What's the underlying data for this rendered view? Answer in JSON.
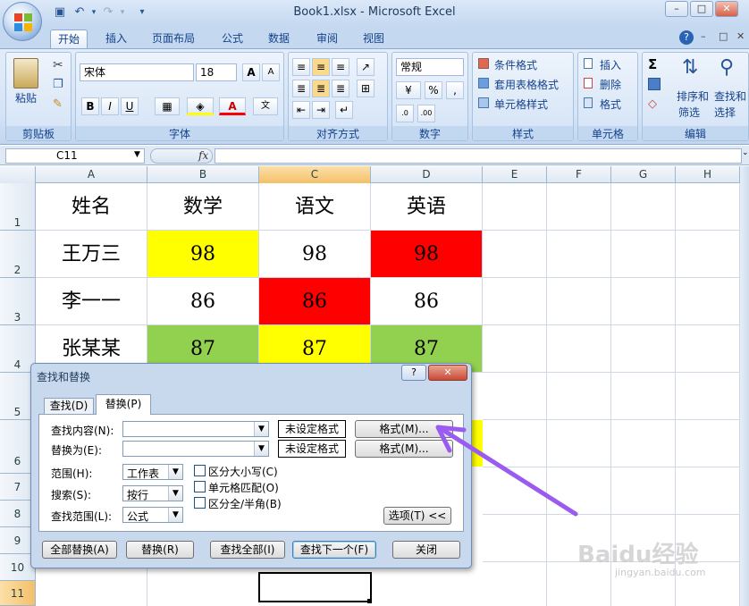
{
  "window": {
    "title": "Book1.xlsx - Microsoft Excel"
  },
  "tabs": [
    {
      "label": "开始"
    },
    {
      "label": "插入"
    },
    {
      "label": "页面布局"
    },
    {
      "label": "公式"
    },
    {
      "label": "数据"
    },
    {
      "label": "审阅"
    },
    {
      "label": "视图"
    }
  ],
  "ribbon": {
    "clipboard": {
      "label": "剪贴板",
      "paste": "粘贴"
    },
    "font": {
      "label": "字体",
      "name": "宋体",
      "size": "18",
      "bold": "B",
      "italic": "I",
      "underline": "U",
      "grow": "A",
      "shrink": "A"
    },
    "align": {
      "label": "对齐方式"
    },
    "number": {
      "label": "数字",
      "format": "常规",
      "percent": "%",
      "comma": ","
    },
    "styles": {
      "label": "样式",
      "cond": "条件格式",
      "table": "套用表格格式",
      "cell": "单元格样式"
    },
    "cells": {
      "label": "单元格",
      "insert": "插入",
      "delete": "删除",
      "format": "格式"
    },
    "editing": {
      "label": "编辑",
      "sort1": "排序和",
      "sort2": "筛选",
      "find1": "查找和",
      "find2": "选择",
      "sigma": "Σ"
    }
  },
  "formula": {
    "namebox": "C11",
    "fx": "fx"
  },
  "sheet": {
    "columns": [
      "A",
      "B",
      "C",
      "D",
      "E",
      "F",
      "G",
      "H"
    ],
    "rows": [
      "1",
      "2",
      "3",
      "4",
      "5",
      "6",
      "7",
      "8",
      "9",
      "10",
      "11"
    ],
    "r1": [
      "姓名",
      "数学",
      "语文",
      "英语"
    ],
    "r2": [
      "王万三",
      "98",
      "98",
      "98"
    ],
    "r3": [
      "李一一",
      "86",
      "86",
      "86"
    ],
    "r4": [
      "张某某",
      "87",
      "87",
      "87"
    ],
    "colors": {
      "yellow": "#ffff00",
      "red": "#ff0000",
      "green": "#92d050",
      "selected_col": "#f8c97a"
    }
  },
  "dialog": {
    "title": "查找和替换",
    "help": "?",
    "tab_find": "查找(D)",
    "tab_replace": "替换(P)",
    "find_label": "查找内容(N):",
    "replace_label": "替换为(E):",
    "noformat1": "未设定格式",
    "noformat2": "未设定格式",
    "format_btn1": "格式(M)...",
    "format_btn2": "格式(M)...",
    "scope_label": "范围(H):",
    "scope_value": "工作表",
    "search_label": "搜索(S):",
    "search_value": "按行",
    "lookin_label": "查找范围(L):",
    "lookin_value": "公式",
    "opt_case": "区分大小写(C)",
    "opt_cell": "单元格匹配(O)",
    "opt_width": "区分全/半角(B)",
    "options_btn": "选项(T) <<",
    "replace_all": "全部替换(A)",
    "replace": "替换(R)",
    "find_all": "查找全部(I)",
    "find_next": "查找下一个(F)",
    "close": "关闭"
  },
  "watermark": {
    "brand": "Baidu经验",
    "url": "jingyan.baidu.com"
  }
}
